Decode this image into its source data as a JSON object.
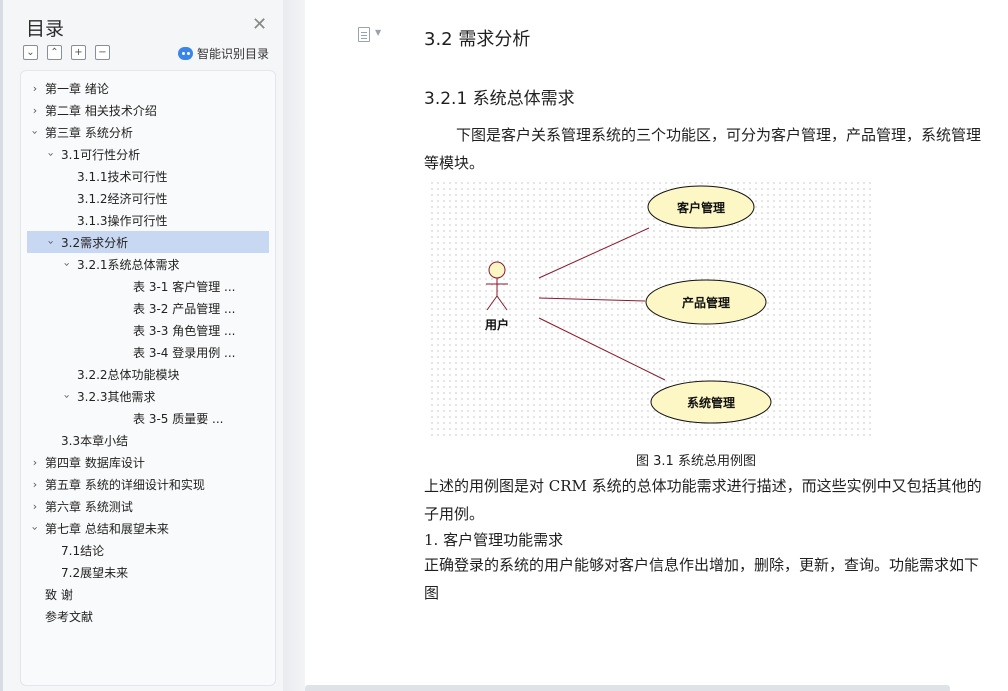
{
  "sidebar": {
    "title": "目录",
    "close_icon": "close-icon",
    "tools": [
      "collapse-all-icon",
      "expand-all-icon",
      "add-icon",
      "remove-icon"
    ],
    "smart_label": "智能识别目录",
    "toc": [
      {
        "label": "第一章  绪论",
        "level": 0,
        "caret": "right"
      },
      {
        "label": "第二章  相关技术介绍",
        "level": 0,
        "caret": "right"
      },
      {
        "label": "第三章  系统分析",
        "level": 0,
        "caret": "down"
      },
      {
        "label": "3.1可行性分析",
        "level": 1,
        "caret": "down"
      },
      {
        "label": "3.1.1技术可行性",
        "level": 2,
        "caret": ""
      },
      {
        "label": "3.1.2经济可行性",
        "level": 2,
        "caret": ""
      },
      {
        "label": "3.1.3操作可行性",
        "level": 2,
        "caret": ""
      },
      {
        "label": "3.2需求分析",
        "level": 1,
        "caret": "down",
        "selected": true
      },
      {
        "label": "3.2.1系统总体需求",
        "level": 2,
        "caret": "down"
      },
      {
        "label": "表 3-1  客户管理 ...",
        "level": 3,
        "caret": ""
      },
      {
        "label": "表 3-2  产品管理 ...",
        "level": 3,
        "caret": ""
      },
      {
        "label": "表 3-3  角色管理 ...",
        "level": 3,
        "caret": ""
      },
      {
        "label": "表 3-4  登录用例 ...",
        "level": 3,
        "caret": ""
      },
      {
        "label": "3.2.2总体功能模块",
        "level": 2,
        "caret": ""
      },
      {
        "label": "3.2.3其他需求",
        "level": 2,
        "caret": "down"
      },
      {
        "label": "表 3-5    质量要 ...",
        "level": 3,
        "caret": ""
      },
      {
        "label": "3.3本章小结",
        "level": 1,
        "caret": ""
      },
      {
        "label": "第四章  数据库设计",
        "level": 0,
        "caret": "right"
      },
      {
        "label": "第五章  系统的详细设计和实现",
        "level": 0,
        "caret": "right"
      },
      {
        "label": "第六章  系统测试",
        "level": 0,
        "caret": "right"
      },
      {
        "label": "第七章  总结和展望未来",
        "level": 0,
        "caret": "down"
      },
      {
        "label": "7.1结论",
        "level": 1,
        "caret": ""
      },
      {
        "label": "7.2展望未来",
        "level": 1,
        "caret": ""
      },
      {
        "label": "致    谢",
        "level": 0,
        "caret": ""
      },
      {
        "label": "参考文献",
        "level": 0,
        "caret": ""
      }
    ]
  },
  "document": {
    "heading_2": "3.2  需求分析",
    "heading_3": "3.2.1  系统总体需求",
    "para_intro": "下图是客户关系管理系统的三个功能区，可分为客户管理，产品管理，系统管理等模块。",
    "figure": {
      "actor_label": "用户",
      "use_cases": [
        "客户管理",
        "产品管理",
        "系统管理"
      ],
      "line_color": "#8b1a2b",
      "ellipse_fill": "#fdf7c6"
    },
    "caption": "图 3.1  系统总用例图",
    "para_after": "上述的用例图是对 CRM 系统的总体功能需求进行描述，而这些实例中又包括其他的子用例。",
    "list_item": "1.  客户管理功能需求",
    "para_last": "正确登录的系统的用户能够对客户信息作出增加，删除，更新，查询。功能需求如下图"
  }
}
